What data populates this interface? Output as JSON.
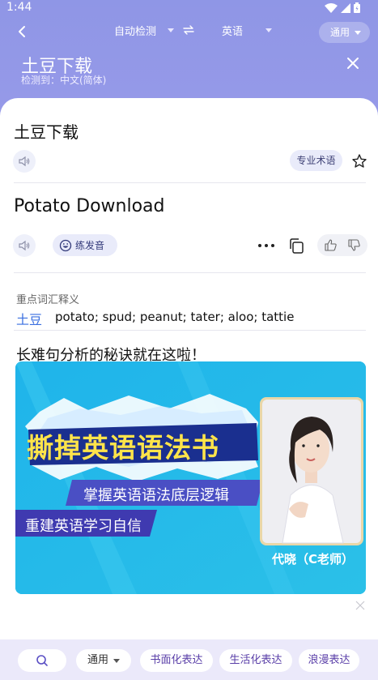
{
  "status": {
    "time": "1:44"
  },
  "topbar": {
    "source_lang": "自动检测",
    "target_lang": "英语",
    "mode": "通用"
  },
  "header": {
    "title": "土豆下载",
    "detected": "检测到：中文(简体)"
  },
  "source": {
    "text": "土豆下载",
    "term_chip": "专业术语"
  },
  "translation": {
    "text": "Potato Download",
    "practice_label": "练发音"
  },
  "vocabulary": {
    "title": "重点词汇释义",
    "items": [
      {
        "word": "土豆",
        "meaning": "potato; spud; peanut; tater; aloo; tattie"
      }
    ]
  },
  "ad": {
    "title": "长难句分析的秘诀就在这啦！",
    "headline": "撕掉英语语法书",
    "line1": "掌握英语语法底层逻辑",
    "line2": "重建英语学习自信",
    "teacher": "代晓（C老师）"
  },
  "bottom": {
    "style_select": "通用",
    "tones": [
      "书面化表达",
      "生活化表达",
      "浪漫表达"
    ]
  },
  "colors": {
    "accent": "#3a6fe0",
    "header_gradient_top": "#8f96e6",
    "ad_background": "#21b7e6",
    "ad_headline": "#ffe44a"
  }
}
